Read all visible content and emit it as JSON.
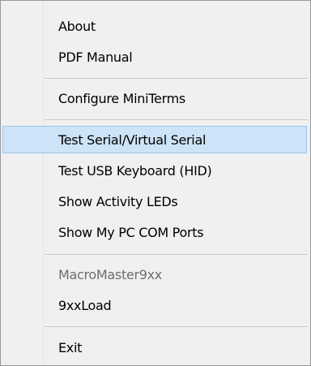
{
  "menu": {
    "items": {
      "about": "About",
      "pdf_manual": "PDF Manual",
      "configure_miniterms": "Configure MiniTerms",
      "test_serial": "Test Serial/Virtual Serial",
      "test_usb_keyboard": "Test USB Keyboard (HID)",
      "show_activity_leds": "Show Activity LEDs",
      "show_com_ports": "Show My PC COM Ports",
      "macromaster": "MacroMaster9xx",
      "load_9xx": "9xxLoad",
      "exit": "Exit"
    },
    "highlighted_item": "test_serial",
    "disabled_item": "macromaster",
    "colors": {
      "background": "#f0f0f0",
      "highlight": "#cde3f7",
      "highlight_border": "#9ac7f0",
      "disabled_text": "#6d6d6d"
    }
  }
}
